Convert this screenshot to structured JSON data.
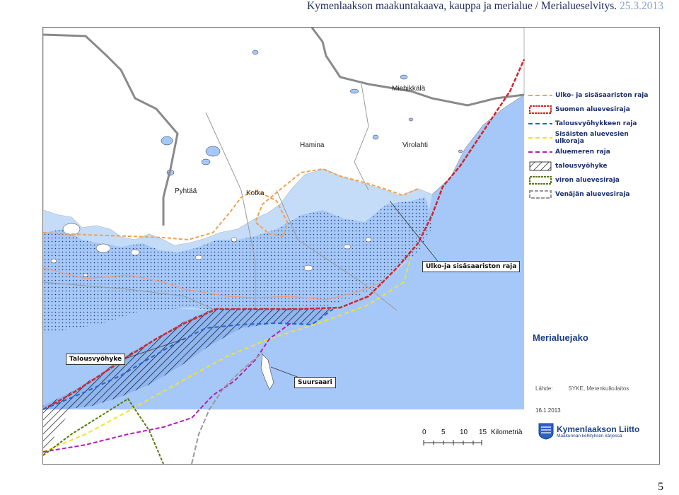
{
  "header": {
    "title": "Kymenlaakson maakuntakaava, kauppa ja merialue / Merialueselvitys.",
    "date": "25.3.2013"
  },
  "places": {
    "miehikkala": "Miehikkälä",
    "hamina": "Hamina",
    "virolahti": "Virolahti",
    "pyhtaa": "Pyhtää",
    "kotka": "Kotka"
  },
  "legend": [
    {
      "label": "Ulko- ja sisäsaariston raja",
      "color": "#f29a7e",
      "style": "dash-thin"
    },
    {
      "label": "Suomen aluevesiraja",
      "color": "#d0262b",
      "style": "box-dotted"
    },
    {
      "label": "Talousvyöhykkeen raja",
      "color": "#2b62c4",
      "style": "dash"
    },
    {
      "label": "Sisäisten aluevesien ulkoraja",
      "color": "#f2e32a",
      "style": "dash"
    },
    {
      "label": "Aluemeren raja",
      "color": "#b01fb8",
      "style": "dash"
    },
    {
      "label": "talousvyöhyke",
      "color": "#1a1a1a",
      "style": "hatch"
    },
    {
      "label": "viron aluevesiraja",
      "color": "#5b7a12",
      "style": "box-dotted"
    },
    {
      "label": "Venäjän aluevesiraja",
      "color": "#999999",
      "style": "box-dashed"
    }
  ],
  "callouts": {
    "archipelago_boundary": "Ulko-ja sisäsaariston raja",
    "economic_zone": "Talousvyöhyke",
    "suursaari": "Suursaari"
  },
  "map_title": "Merialuejako",
  "source": {
    "label": "Lähde:",
    "value": "SYKE, Merenkulkulaitos"
  },
  "map_date": "16.1.2013",
  "scale": {
    "ticks": [
      "0",
      "5",
      "10",
      "15"
    ],
    "unit": "Kilometriä"
  },
  "organization": {
    "name": "Kymenlaakson Liitto",
    "subtitle": "Maakunnan kehityksen kärjessä"
  },
  "page_number": "5",
  "colors": {
    "sea": "#a6c8f8",
    "land": "#ffffff",
    "inner_sea": "#c4dcf8",
    "economic_zone": "#8fb6f0"
  }
}
